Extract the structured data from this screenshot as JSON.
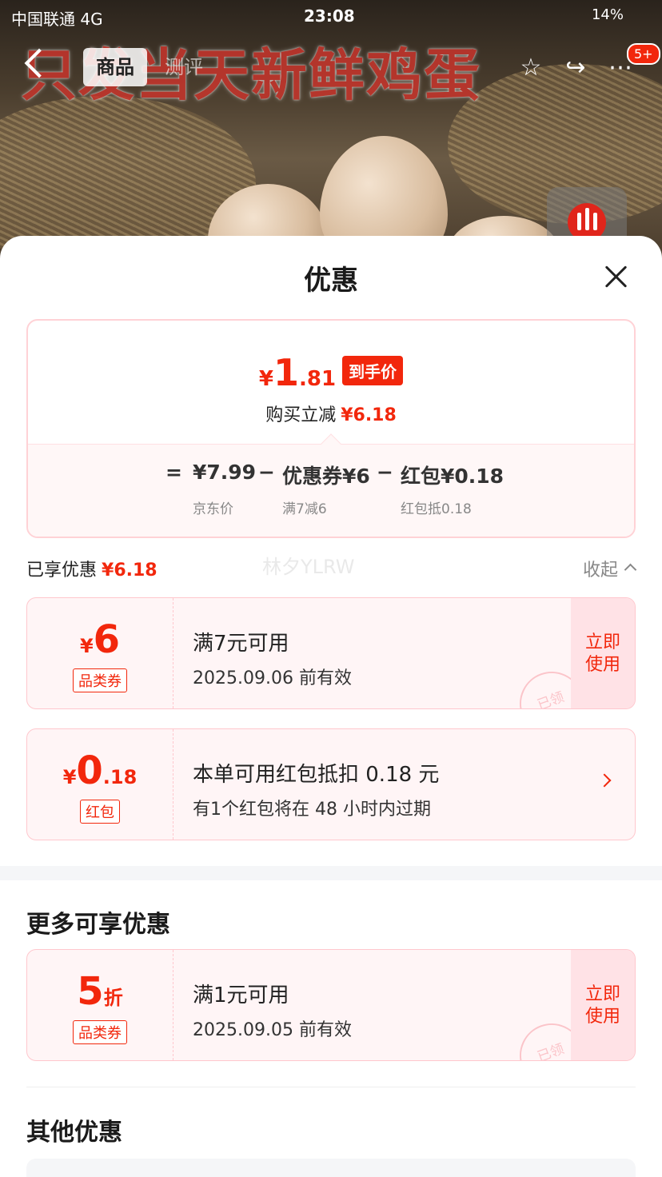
{
  "status_bar": {
    "carrier": "中国联通 4G",
    "time": "23:08",
    "battery": "14%"
  },
  "hero": {
    "banner_text": "只发当天新鲜鸡蛋"
  },
  "top_nav": {
    "tabs": [
      "商品",
      "测评"
    ],
    "badge": "5+",
    "icons": [
      "back-icon",
      "star-icon",
      "share-icon",
      "more-icon"
    ]
  },
  "sheet": {
    "title": "优惠",
    "price_card": {
      "currency": "¥",
      "price_int": "1",
      "price_dec": ".81",
      "price_tag": "到手价",
      "reduce_label": "购买立减",
      "reduce_value": "¥6.18",
      "equals": "=",
      "minus": "−",
      "base_price": "¥7.99",
      "base_label": "京东价",
      "coupon_part": "优惠券¥6",
      "coupon_sub": "满7减6",
      "redpacket_part": "红包¥0.18",
      "redpacket_sub": "红包抵0.18"
    },
    "enjoyed": {
      "label": "已享优惠",
      "value": "¥6.18",
      "collapse": "收起"
    },
    "watermark": "林夕YLRW",
    "coupons": [
      {
        "currency": "¥",
        "amount": "6",
        "decimal": "",
        "kind": "品类券",
        "main": "满7元可用",
        "sub": "2025.09.06 前有效",
        "action": "立即\n使用",
        "stamp": "已领"
      },
      {
        "currency": "¥",
        "amount": "0",
        "decimal": ".18",
        "kind": "红包",
        "main": "本单可用红包抵扣 0.18 元",
        "sub": "有1个红包将在 48 小时内过期"
      }
    ],
    "more_title": "更多可享优惠",
    "more_coupons": [
      {
        "amount": "5",
        "unit": "折",
        "kind": "品类券",
        "main": "满1元可用",
        "sub": "2025.09.05 前有效",
        "action": "立即\n使用",
        "stamp": "已领"
      }
    ],
    "other_title": "其他优惠"
  },
  "colors": {
    "accent": "#f2270c",
    "coupon_bg": "#fff5f6",
    "coupon_border": "#ffc7cd"
  }
}
